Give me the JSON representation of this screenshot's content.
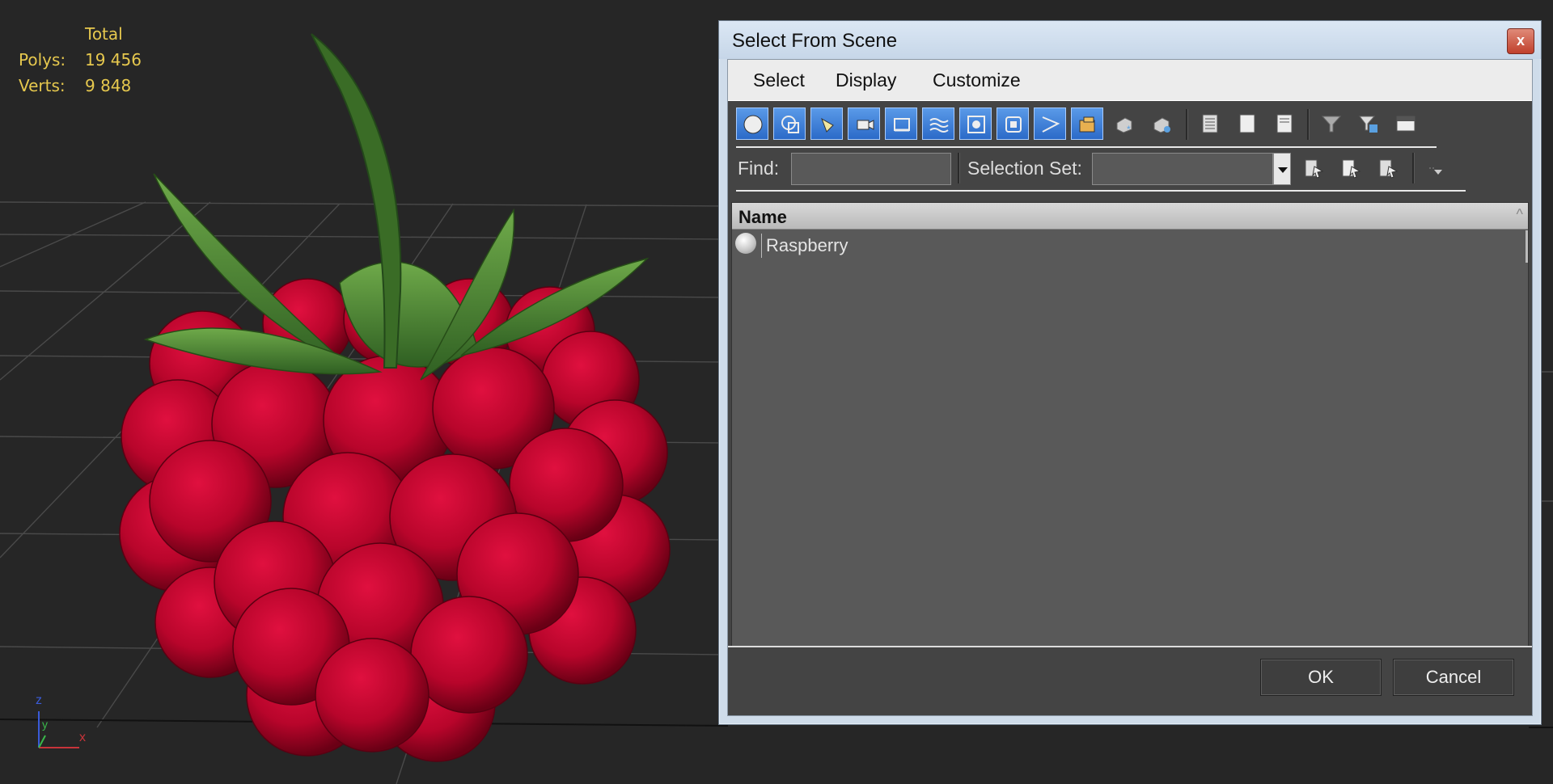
{
  "viewport": {
    "stats": {
      "header": "Total",
      "polys_label": "Polys:",
      "polys_value": "19 456",
      "verts_label": "Verts:",
      "verts_value": "9 848"
    },
    "axis": {
      "z": "z",
      "y": "y",
      "x": "x"
    },
    "colors": {
      "stats": "#e6c84e",
      "background": "#262626",
      "berry": "#c4062e",
      "leaf": "#3f7a2a"
    }
  },
  "dialog": {
    "title": "Select From Scene",
    "close_glyph": "x",
    "menu": [
      "Select",
      "Display",
      "Customize"
    ],
    "toolbar_icons": [
      "geometry-icon",
      "shapes-icon",
      "lights-icon",
      "cameras-icon",
      "helpers-icon",
      "space-warps-icon",
      "groups-icon",
      "xrefs-icon",
      "bones-icon",
      "containers-icon",
      "frozen-icon",
      "hidden-icon",
      "select-all-icon",
      "select-none-icon",
      "select-invert-icon",
      "filter-icon",
      "filter-options-icon",
      "layer-icon"
    ],
    "find_label": "Find:",
    "find_value": "",
    "selection_set_label": "Selection Set:",
    "selection_set_value": "",
    "list": {
      "column_name": "Name",
      "sort_glyph": "^",
      "items": [
        {
          "name": "Raspberry",
          "icon": "geometry-icon"
        }
      ]
    },
    "ok_label": "OK",
    "cancel_label": "Cancel",
    "colors": {
      "active_toggle": "#2b6ac8",
      "title_bar": "#cfdcea",
      "panel": "#444444"
    }
  }
}
